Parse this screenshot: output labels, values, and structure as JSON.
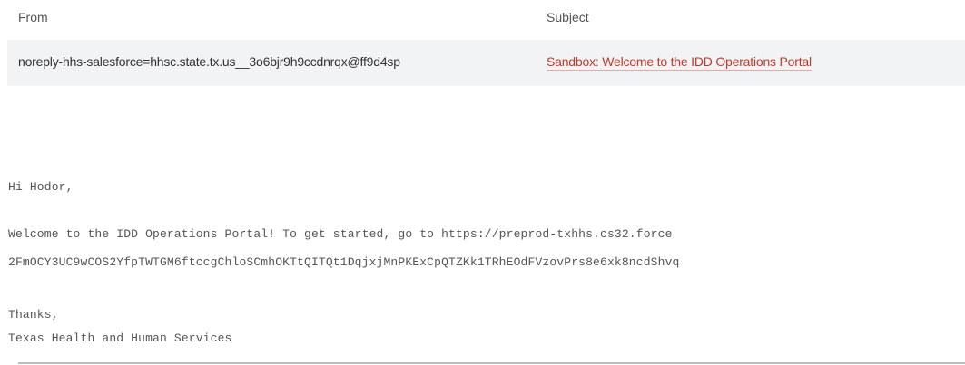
{
  "table": {
    "headers": {
      "from": "From",
      "subject": "Subject"
    },
    "row": {
      "from": "noreply-hhs-salesforce=hhsc.state.tx.us__3o6bjr9h9ccdnrqx@ff9d4sp",
      "subject": "Sandbox: Welcome to the IDD Operations Portal"
    }
  },
  "message": {
    "greeting": "Hi Hodor,",
    "body_line_1": "Welcome to the IDD Operations Portal!  To get started, go to https://preprod-txhhs.cs32.force",
    "body_line_2": "2FmOCY3UC9wCOS2YfpTWTGM6ftccgChloSCmhOKTtQITQt1DqjxjMnPKExCpQTZKk1TRhEOdFVzovPrs8e6xk8ncdShvq",
    "closing": "Thanks,",
    "signature": "Texas Health and Human Services"
  },
  "colors": {
    "subject_link": "#c0392b",
    "row_background": "#f2f3f5",
    "header_text": "#555555"
  }
}
